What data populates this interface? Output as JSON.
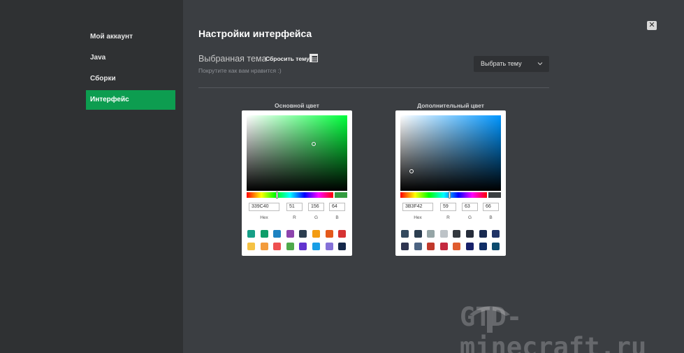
{
  "sidebar": {
    "items": [
      {
        "label": "Мой аккаунт",
        "active": false
      },
      {
        "label": "Java",
        "active": false
      },
      {
        "label": "Сборки",
        "active": false
      },
      {
        "label": "Интерфейс",
        "active": true
      }
    ]
  },
  "header": {
    "title": "Настройки интерфейса",
    "close_icon": "close-icon"
  },
  "theme": {
    "label": "Выбранная тема",
    "reset_label": "Сбросить тему",
    "reset_icon": "table-icon",
    "subtitle": "Покрутите как вам нравится :)",
    "select_label": "Выбрать тему"
  },
  "primary": {
    "title": "Основной цвет",
    "hex": "339C40",
    "r": "51",
    "g": "156",
    "b": "64",
    "hue_color": "#00ff3c",
    "preview_color": "#339c40",
    "labels": {
      "hex": "Hex",
      "r": "R",
      "g": "G",
      "b": "B"
    },
    "swatches": [
      "#169f87",
      "#0e9d69",
      "#1d82c1",
      "#8d44ad",
      "#2c3e50",
      "#f39c12",
      "#e4591b",
      "#d63333",
      "#f5c244",
      "#f39c3c",
      "#ee5050",
      "#4fa94b",
      "#6234cf",
      "#189ee6",
      "#8571d8",
      "#15284a"
    ]
  },
  "secondary": {
    "title": "Дополнительный цвет",
    "hex": "3B3F42",
    "r": "59",
    "g": "63",
    "b": "66",
    "hue_color": "#0096ff",
    "preview_color": "#3b3f42",
    "labels": {
      "hex": "Hex",
      "r": "R",
      "g": "G",
      "b": "B"
    },
    "swatches": [
      "#34495e",
      "#2c3e50",
      "#95a5a6",
      "#bdc3c7",
      "#34393f",
      "#252c3a",
      "#192a51",
      "#1f3366",
      "#2f3550",
      "#4b6382",
      "#c0392b",
      "#c4293f",
      "#e05c2e",
      "#18216a",
      "#102e66",
      "#0c4a6e"
    ]
  },
  "watermark": {
    "text": "GTD-minecraft.ru"
  }
}
